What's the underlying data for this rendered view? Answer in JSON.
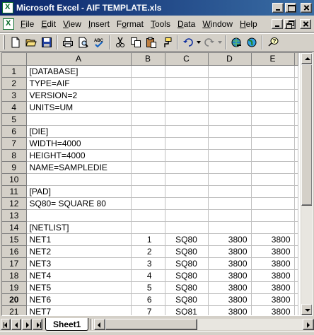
{
  "window": {
    "title": "Microsoft Excel - AIF TEMPLATE.xls",
    "controls": [
      "minimize",
      "maximize",
      "close"
    ]
  },
  "menubar": {
    "items": [
      {
        "label": "File",
        "accel": "F"
      },
      {
        "label": "Edit",
        "accel": "E"
      },
      {
        "label": "View",
        "accel": "V"
      },
      {
        "label": "Insert",
        "accel": "I"
      },
      {
        "label": "Format",
        "accel": "o"
      },
      {
        "label": "Tools",
        "accel": "T"
      },
      {
        "label": "Data",
        "accel": "D"
      },
      {
        "label": "Window",
        "accel": "W"
      },
      {
        "label": "Help",
        "accel": "H"
      }
    ],
    "doc_controls": [
      "minimize",
      "restore",
      "close"
    ]
  },
  "toolbar": {
    "buttons": [
      "new-icon",
      "open-icon",
      "save-icon",
      "print-icon",
      "print-preview-icon",
      "spelling-icon",
      "cut-icon",
      "copy-icon",
      "paste-icon",
      "format-painter-icon",
      "undo-icon",
      "redo-icon",
      "insert-hyperlink-icon",
      "web-toolbar-icon",
      "help-icon"
    ]
  },
  "sheet": {
    "columns": [
      "A",
      "B",
      "C",
      "D",
      "E"
    ],
    "active_row": 20,
    "rows": [
      {
        "n": "1",
        "cells": [
          "[DATABASE]",
          "",
          "",
          "",
          ""
        ]
      },
      {
        "n": "2",
        "cells": [
          "TYPE=AIF",
          "",
          "",
          "",
          ""
        ]
      },
      {
        "n": "3",
        "cells": [
          "VERSION=2",
          "",
          "",
          "",
          ""
        ]
      },
      {
        "n": "4",
        "cells": [
          "UNITS=UM",
          "",
          "",
          "",
          ""
        ]
      },
      {
        "n": "5",
        "cells": [
          "",
          "",
          "",
          "",
          ""
        ]
      },
      {
        "n": "6",
        "cells": [
          "[DIE]",
          "",
          "",
          "",
          ""
        ]
      },
      {
        "n": "7",
        "cells": [
          "WIDTH=4000",
          "",
          "",
          "",
          ""
        ]
      },
      {
        "n": "8",
        "cells": [
          "HEIGHT=4000",
          "",
          "",
          "",
          ""
        ]
      },
      {
        "n": "9",
        "cells": [
          "NAME=SAMPLEDIE",
          "",
          "",
          "",
          ""
        ]
      },
      {
        "n": "10",
        "cells": [
          "",
          "",
          "",
          "",
          ""
        ]
      },
      {
        "n": "11",
        "cells": [
          "[PAD]",
          "",
          "",
          "",
          ""
        ]
      },
      {
        "n": "12",
        "cells": [
          "SQ80= SQUARE 80",
          "",
          "",
          "",
          ""
        ]
      },
      {
        "n": "13",
        "cells": [
          "",
          "",
          "",
          "",
          ""
        ]
      },
      {
        "n": "14",
        "cells": [
          "[NETLIST]",
          "",
          "",
          "",
          ""
        ]
      },
      {
        "n": "15",
        "cells": [
          "NET1",
          "1",
          "SQ80",
          "3800",
          "3800"
        ]
      },
      {
        "n": "16",
        "cells": [
          "NET2",
          "2",
          "SQ80",
          "3800",
          "3800"
        ]
      },
      {
        "n": "17",
        "cells": [
          "NET3",
          "3",
          "SQ80",
          "3800",
          "3800"
        ]
      },
      {
        "n": "18",
        "cells": [
          "NET4",
          "4",
          "SQ80",
          "3800",
          "3800"
        ]
      },
      {
        "n": "19",
        "cells": [
          "NET5",
          "5",
          "SQ80",
          "3800",
          "3800"
        ]
      },
      {
        "n": "20",
        "cells": [
          "NET6",
          "6",
          "SQ80",
          "3800",
          "3800"
        ]
      },
      {
        "n": "21",
        "cells": [
          "NET7",
          "7",
          "SQ81",
          "3800",
          "3800"
        ]
      }
    ]
  },
  "tabs": {
    "sheets": [
      "Sheet1"
    ],
    "active": "Sheet1"
  },
  "colors": {
    "title_gradient_start": "#0a246a",
    "title_gradient_end": "#3a6ea5",
    "chrome": "#d4d0c8",
    "gridline": "#c0c0c0"
  }
}
